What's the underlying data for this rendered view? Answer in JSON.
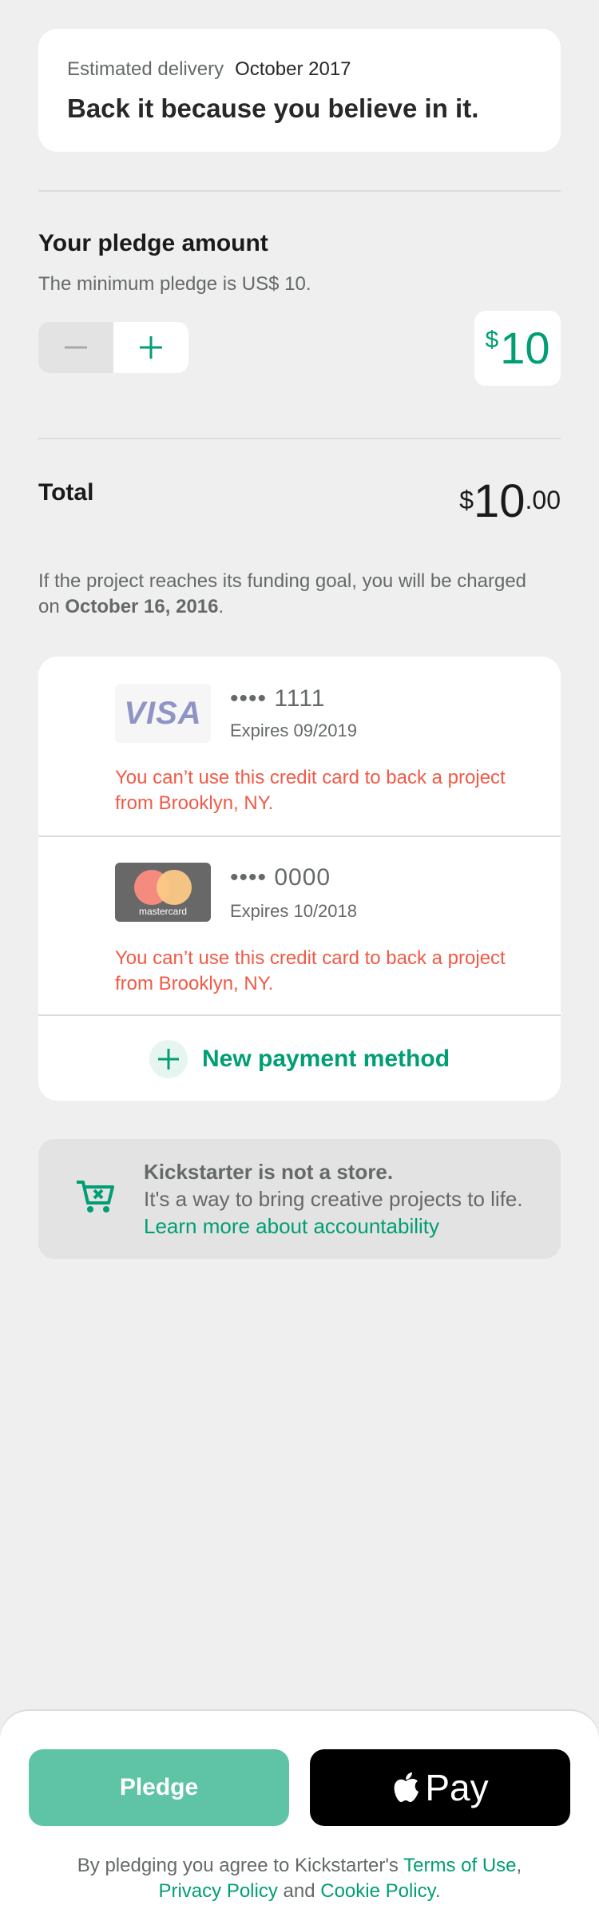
{
  "header": {
    "estimated_delivery_label": "Estimated delivery",
    "estimated_delivery_value": "October 2017",
    "title": "Back it because you believe in it."
  },
  "pledge": {
    "section_title": "Your pledge amount",
    "minimum_text": "The minimum pledge is US$ 10.",
    "currency_symbol": "$",
    "amount": "10"
  },
  "total": {
    "label": "Total",
    "currency_symbol": "$",
    "whole": "10",
    "cents": ".00"
  },
  "funding_note": {
    "prefix": "If the project reaches its funding goal, you will be charged on ",
    "date": "October 16, 2016",
    "suffix": "."
  },
  "payment_methods": [
    {
      "brand": "VISA",
      "number": "•••• 1111",
      "expires": "Expires 09/2019",
      "error": "You can’t use this credit card to back a project from Brooklyn, NY."
    },
    {
      "brand": "mastercard",
      "number": "•••• 0000",
      "expires": "Expires 10/2018",
      "error": "You can’t use this credit card to back a project from Brooklyn, NY."
    }
  ],
  "new_payment_label": "New payment method",
  "store_notice": {
    "title": "Kickstarter is not a store.",
    "body": "It's a way to bring creative projects to life. ",
    "link": "Learn more about accountability"
  },
  "footer": {
    "pledge_button": "Pledge",
    "apple_pay_label": "Pay",
    "terms_prefix": "By pledging you agree to Kickstarter's ",
    "terms_link": "Terms of Use",
    "sep1": ", ",
    "privacy_link": "Privacy Policy",
    "sep2": " and ",
    "cookie_link": "Cookie Policy",
    "end": "."
  },
  "colors": {
    "accent": "#009e74",
    "pledge_button": "#5ec4a5",
    "error": "#f05a46",
    "background": "#efefef"
  }
}
